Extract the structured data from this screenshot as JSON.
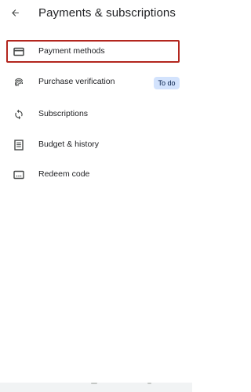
{
  "header": {
    "back_icon": "arrow-back-icon",
    "title": "Payments & subscriptions"
  },
  "menu": {
    "items": [
      {
        "label": "Payment methods",
        "icon": "credit-card-icon",
        "selected": true
      },
      {
        "label": "Purchase verification",
        "icon": "fingerprint-icon",
        "badge": "To do"
      },
      {
        "label": "Subscriptions",
        "icon": "sync-icon"
      },
      {
        "label": "Budget & history",
        "icon": "receipt-icon"
      },
      {
        "label": "Redeem code",
        "icon": "redeem-code-icon"
      }
    ]
  },
  "colors": {
    "highlight_border": "#b3261e",
    "badge_background": "#d3e3fd",
    "icon": "#444746"
  }
}
